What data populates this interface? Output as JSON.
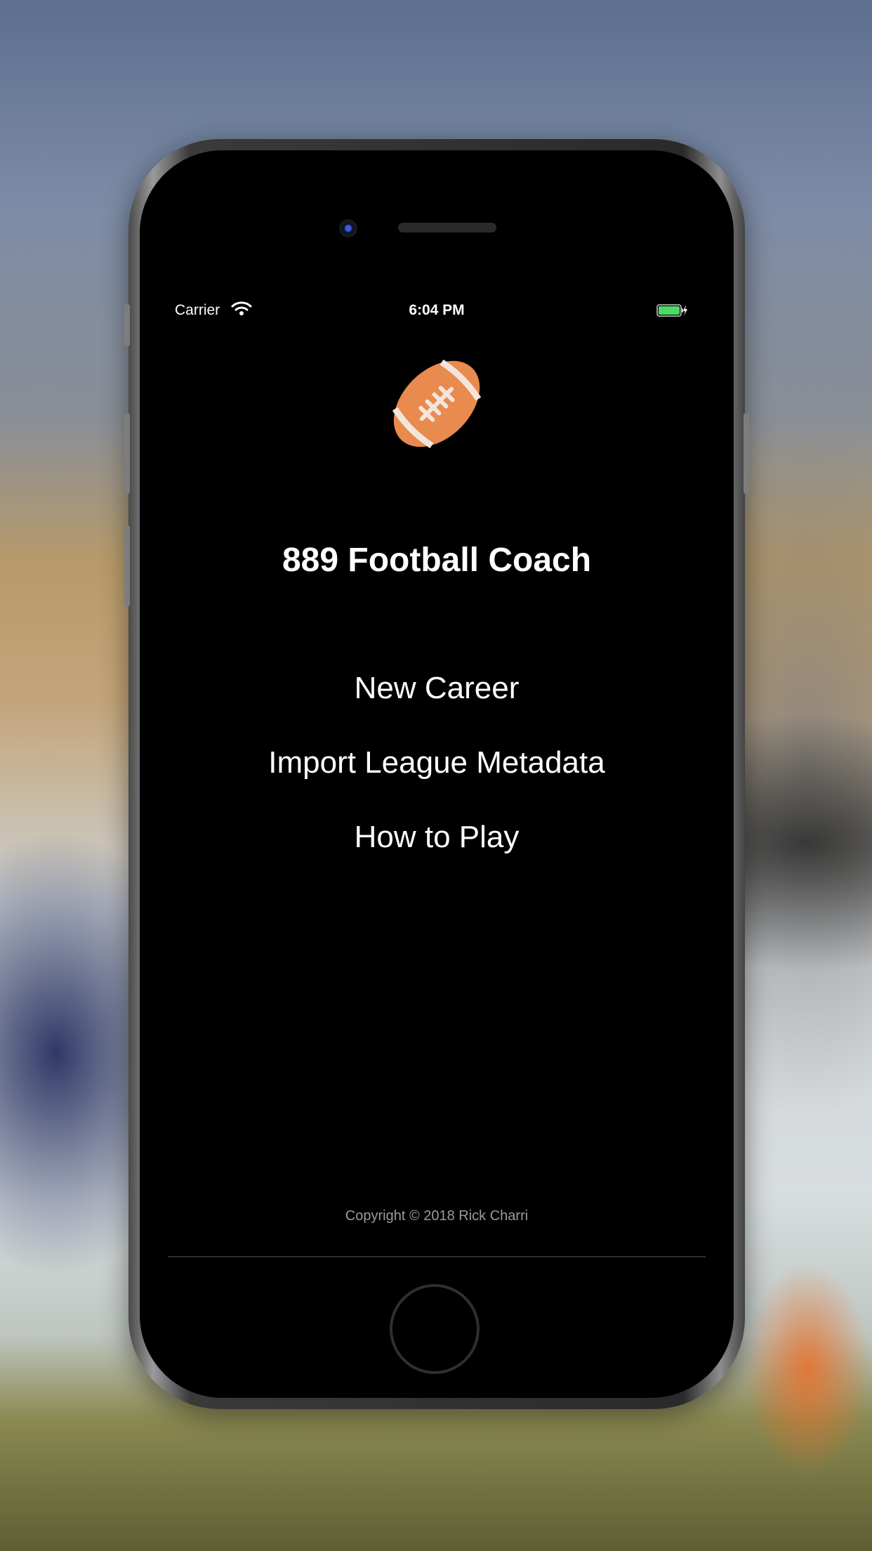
{
  "status_bar": {
    "carrier": "Carrier",
    "time": "6:04 PM",
    "wifi_icon": "wifi-icon",
    "battery_icon": "battery-charging-icon",
    "battery_color": "#4cd964"
  },
  "app": {
    "logo_icon": "football-icon",
    "title": "889 Football Coach"
  },
  "menu": {
    "items": [
      {
        "label": "New Career"
      },
      {
        "label": "Import League Metadata"
      },
      {
        "label": "How to Play"
      }
    ]
  },
  "footer": {
    "copyright": "Copyright © 2018 Rick Charri"
  },
  "colors": {
    "background": "#000000",
    "text": "#ffffff",
    "football": "#e98a4f",
    "laces": "#f2e6dc"
  }
}
